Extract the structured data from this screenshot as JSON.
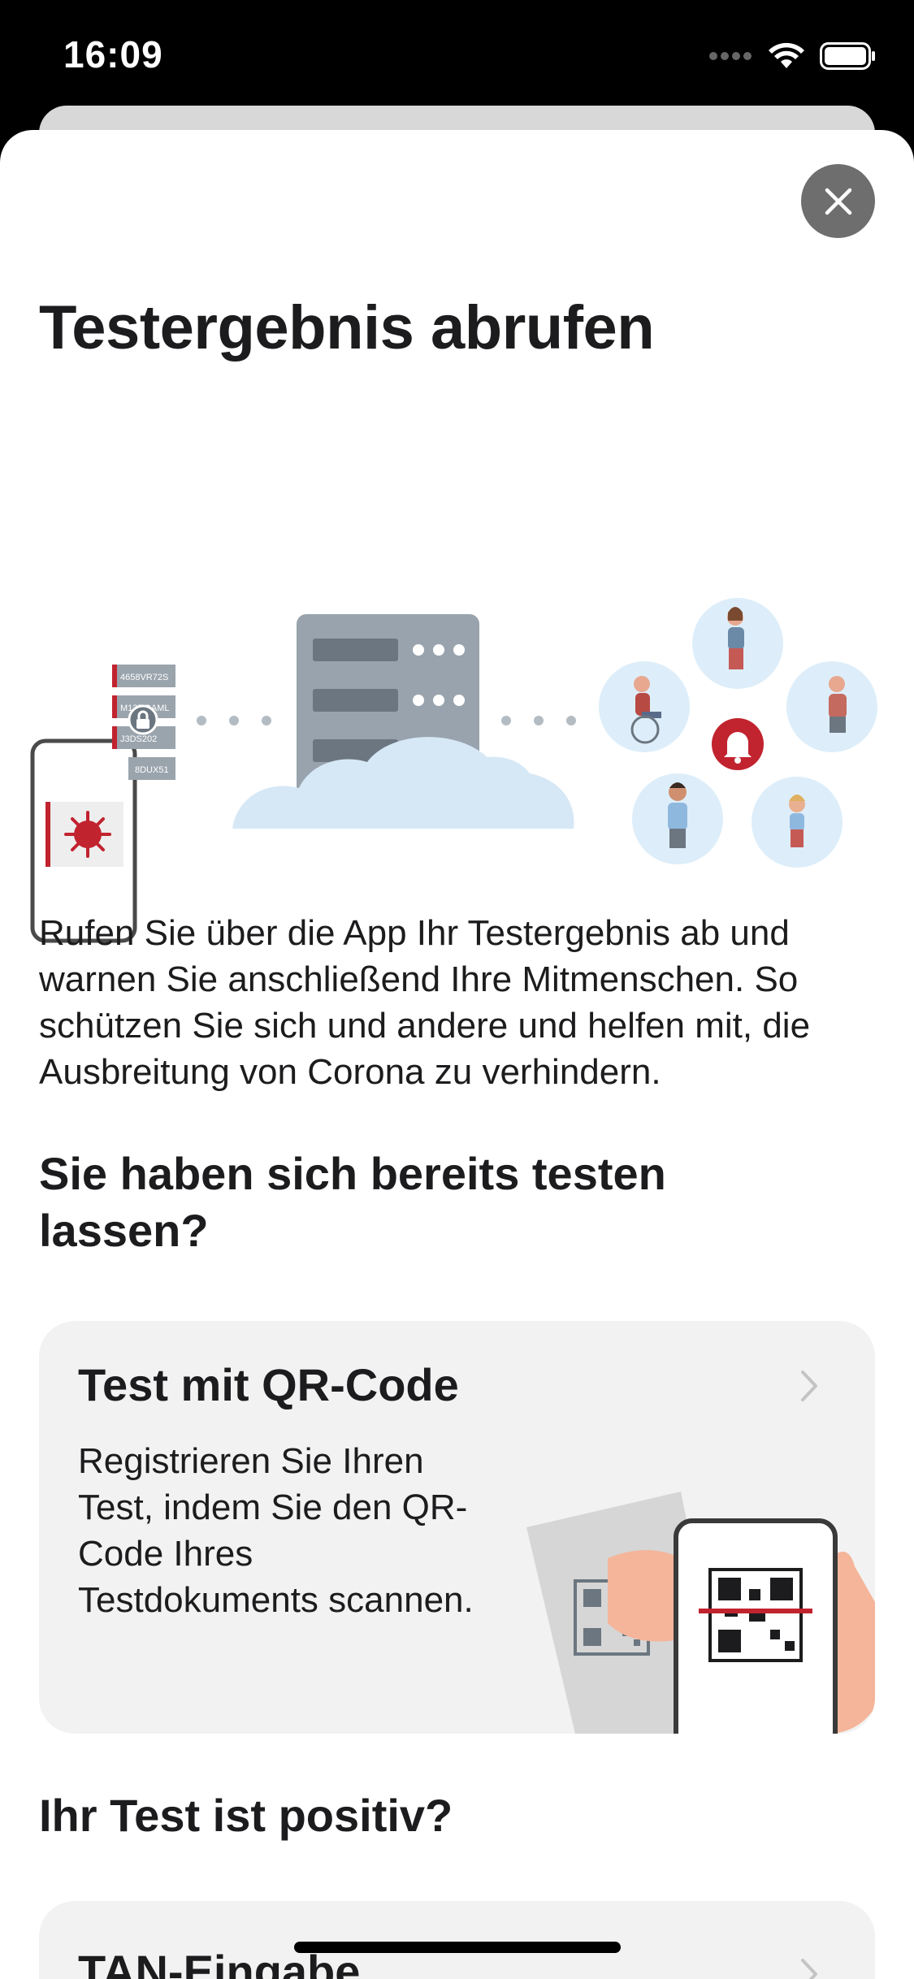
{
  "status_bar": {
    "time": "16:09"
  },
  "title": "Testergebnis abrufen",
  "hero": {
    "codes": [
      "4658VR72S",
      "M13DOAML",
      "J3DS202",
      "8DUX51"
    ]
  },
  "intro": "Rufen Sie über die App Ihr Testergebnis ab und warnen Sie anschließend Ihre Mitmenschen. So schützen Sie sich und andere und helfen mit, die Ausbreitung von Corona zu verhindern.",
  "section_tested": "Sie haben sich bereits testen lassen?",
  "qr_card": {
    "title": "Test mit QR-Code",
    "description": "Registrieren Sie Ihren Test, indem Sie den QR-Code Ihres Testdokuments scannen."
  },
  "section_positive": "Ihr Test ist positiv?",
  "tan_card": {
    "title": "TAN-Eingabe"
  },
  "colors": {
    "accent": "#c1232f",
    "card_bg": "#f2f2f2",
    "text": "#1c1c1e"
  }
}
